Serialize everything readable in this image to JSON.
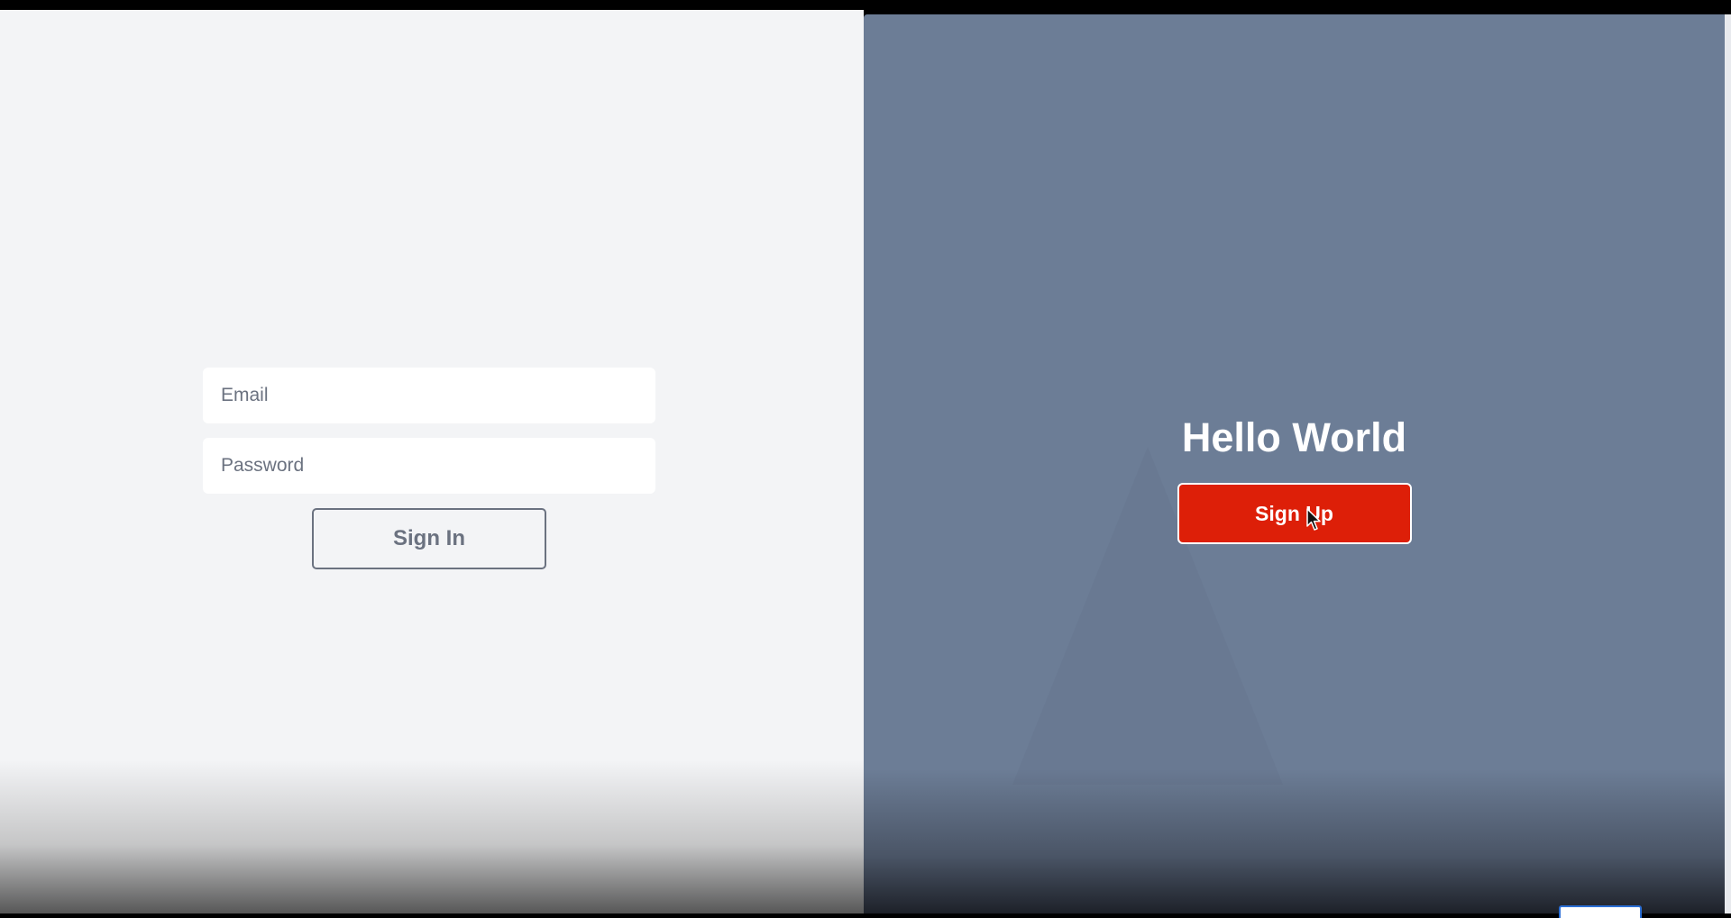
{
  "login_form": {
    "email_placeholder": "Email",
    "password_placeholder": "Password",
    "sign_in_label": "Sign In"
  },
  "hero": {
    "title": "Hello World",
    "sign_up_label": "Sign Up"
  },
  "colors": {
    "left_background": "#f3f4f6",
    "right_background": "#6c7d96",
    "sign_up_button": "#dd1f08",
    "sign_in_border": "#6b7280"
  },
  "icons": [
    "mouse-pointer-icon"
  ]
}
